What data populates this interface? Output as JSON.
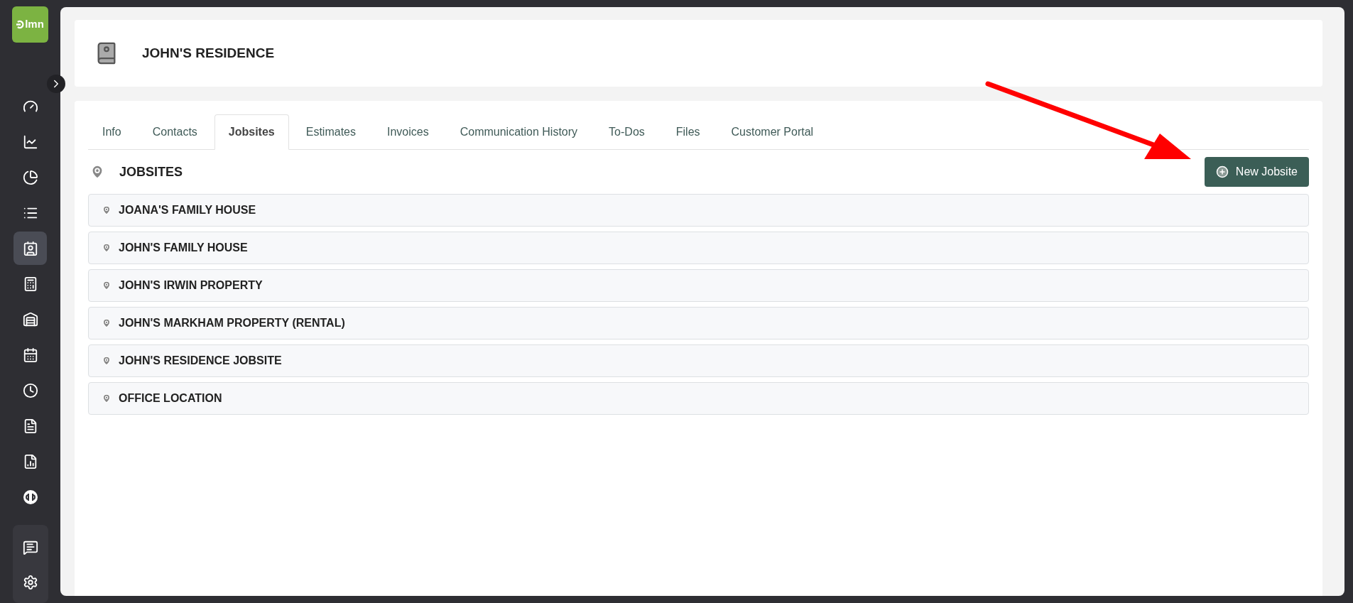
{
  "logo": {
    "text": "lmn"
  },
  "nav": [
    {
      "kind": "dashboard",
      "selected": false
    },
    {
      "kind": "trend",
      "selected": false
    },
    {
      "kind": "pie",
      "selected": false
    },
    {
      "kind": "list",
      "selected": false
    },
    {
      "kind": "contact",
      "selected": true
    },
    {
      "kind": "calculator",
      "selected": false
    },
    {
      "kind": "garage",
      "selected": false
    },
    {
      "kind": "calendar",
      "selected": false
    },
    {
      "kind": "clock",
      "selected": false
    },
    {
      "kind": "invoice",
      "selected": false
    },
    {
      "kind": "report",
      "selected": false
    },
    {
      "kind": "qb",
      "selected": false
    }
  ],
  "nav_bottom": [
    {
      "kind": "help"
    },
    {
      "kind": "settings"
    }
  ],
  "header": {
    "title": "JOHN'S RESIDENCE"
  },
  "tabs": [
    {
      "label": "Info",
      "selected": false
    },
    {
      "label": "Contacts",
      "selected": false
    },
    {
      "label": "Jobsites",
      "selected": true
    },
    {
      "label": "Estimates",
      "selected": false
    },
    {
      "label": "Invoices",
      "selected": false
    },
    {
      "label": "Communication History",
      "selected": false
    },
    {
      "label": "To-Dos",
      "selected": false
    },
    {
      "label": "Files",
      "selected": false
    },
    {
      "label": "Customer Portal",
      "selected": false
    }
  ],
  "section": {
    "title": "JOBSITES",
    "button": "New Jobsite"
  },
  "jobsites": [
    "JOANA'S FAMILY HOUSE",
    "JOHN'S FAMILY HOUSE",
    "JOHN'S IRWIN PROPERTY",
    "JOHN'S MARKHAM PROPERTY (RENTAL)",
    "JOHN'S RESIDENCE JOBSITE",
    "OFFICE LOCATION"
  ],
  "annotation": {
    "kind": "arrow"
  }
}
